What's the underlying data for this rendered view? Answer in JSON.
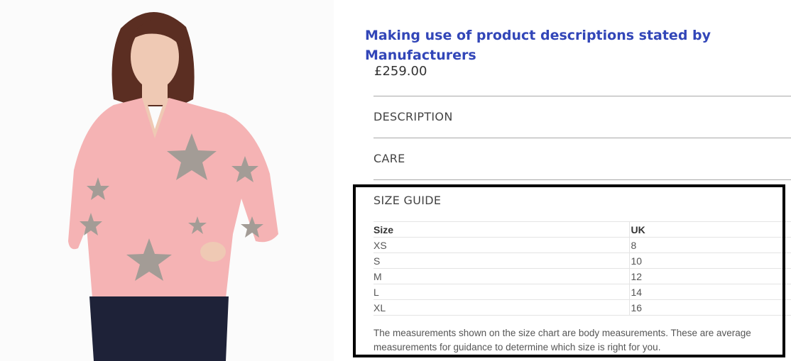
{
  "annotation": {
    "title": "Making use of product descriptions stated by Manufacturers"
  },
  "product": {
    "image_alt": "Woman wearing a pink V-neck jumper with grey stars",
    "price": "£259.00",
    "accordion": [
      {
        "label": "DESCRIPTION"
      },
      {
        "label": "CARE"
      },
      {
        "label": "SIZE GUIDE"
      }
    ]
  },
  "size_guide": {
    "headers": [
      "Size",
      "UK"
    ],
    "rows": [
      [
        "XS",
        "8"
      ],
      [
        "S",
        "10"
      ],
      [
        "M",
        "12"
      ],
      [
        "L",
        "14"
      ],
      [
        "XL",
        "16"
      ]
    ],
    "note": "The measurements shown on the size chart are body measurements. These are average measurements for guidance to determine which size is right for you."
  },
  "colors": {
    "annotation_title": "#3246b8",
    "jumper": "#f5b3b4",
    "stars": "#a39c96",
    "highlight_border": "#000000"
  }
}
